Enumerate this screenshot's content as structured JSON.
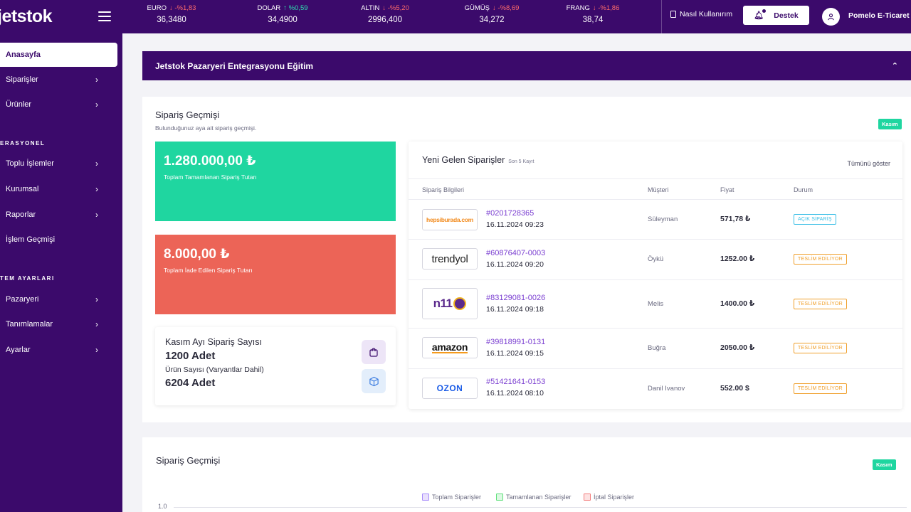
{
  "app": {
    "logo": "jetstok",
    "brand_color": "#3b0a6b"
  },
  "sidebar": {
    "active": "Anasayfa",
    "items": [
      {
        "label": "Siparişler"
      },
      {
        "label": "Ürünler"
      }
    ],
    "section1": "ERASYONEL",
    "section1_items": [
      {
        "label": "Toplu İşlemler"
      },
      {
        "label": "Kurumsal"
      },
      {
        "label": "Raporlar"
      },
      {
        "label": "İşlem Geçmişi"
      }
    ],
    "section2": "TEM AYARLARI",
    "section2_items": [
      {
        "label": "Pazaryeri"
      },
      {
        "label": "Tanımlamalar"
      },
      {
        "label": "Ayarlar"
      }
    ]
  },
  "topbar": {
    "tickers": [
      {
        "name": "EURO",
        "change": "↓ -%1,83",
        "dir": "down",
        "value": "36,3480"
      },
      {
        "name": "DOLAR",
        "change": "↑ %0,59",
        "dir": "up",
        "value": "34,4900"
      },
      {
        "name": "ALTIN",
        "change": "↓ -%5,20",
        "dir": "down",
        "value": "2996,400"
      },
      {
        "name": "GÜMÜŞ",
        "change": "↓ -%8,69",
        "dir": "down",
        "value": "34,272"
      },
      {
        "name": "FRANG",
        "change": "↓ -%1,86",
        "dir": "down",
        "value": "38,74"
      }
    ],
    "howto": "Nasıl Kullanırım",
    "support": "Destek",
    "user": "Pomelo E-Ticaret"
  },
  "banner": {
    "title": "Jetstok Pazaryeri Entegrasyonu Eğitim"
  },
  "order_history": {
    "title": "Sipariş Geçmişi",
    "subtitle": "Bulunduğunuz aya ait sipariş geçmişi.",
    "badge": "Kasım",
    "completed_total": "1.280.000,00 ₺",
    "completed_label": "Toplam Tamamlanan Sipariş Tutarı",
    "refund_total": "8.000,00 ₺",
    "refund_label": "Toplam İade Edilen Sipariş Tutarı",
    "count_label": "Kasım Ayı Sipariş Sayısı",
    "count_value": "1200 Adet",
    "product_label": "Ürün Sayısı (Varyantlar Dahil)",
    "product_value": "6204 Adet"
  },
  "new_orders": {
    "title": "Yeni Gelen Siparişler",
    "subtitle": "Son 5 Kayıt",
    "show_all": "Tümünü göster",
    "columns": [
      "Sipariş Bilgileri",
      "Müşteri",
      "Fiyat",
      "Durum"
    ],
    "rows": [
      {
        "market": "hepsiburada",
        "logo": "hepsiburada.com",
        "no": "#0201728365",
        "date": "16.11.2024 09:23",
        "customer": "Süleyman",
        "price": "571,78 ₺",
        "status": "AÇIK SİPARİŞ",
        "status_type": "open"
      },
      {
        "market": "trendyol",
        "logo": "trendyol",
        "no": "#60876407-0003",
        "date": "16.11.2024 09:20",
        "customer": "Öykü",
        "price": "1252.00 ₺",
        "status": "TESLİM EDİLİYOR",
        "status_type": "ship"
      },
      {
        "market": "n11",
        "logo": "n11",
        "no": "#83129081-0026",
        "date": "16.11.2024 09:18",
        "customer": "Melis",
        "price": "1400.00 ₺",
        "status": "TESLİM EDİLİYOR",
        "status_type": "ship"
      },
      {
        "market": "amazon",
        "logo": "amazon",
        "no": "#39818991-0131",
        "date": "16.11.2024 09:15",
        "customer": "Buğra",
        "price": "2050.00 ₺",
        "status": "TESLİM EDİLİYOR",
        "status_type": "ship"
      },
      {
        "market": "ozon",
        "logo": "OZON",
        "no": "#51421641-0153",
        "date": "16.11.2024 08:10",
        "customer": "Danil Ivanov",
        "price": "552.00 $",
        "status": "TESLİM EDİLİYOR",
        "status_type": "ship"
      }
    ]
  },
  "chart_card": {
    "title": "Sipariş Geçmişi",
    "badge": "Kasım",
    "legend": [
      "Toplam  Siparişler",
      "Tamamlanan Siparişler",
      "İptal Siparişler"
    ],
    "legend_colors": [
      "#a78bfa",
      "#5ee07a",
      "#f37c7c"
    ],
    "ytick": "1.0"
  }
}
